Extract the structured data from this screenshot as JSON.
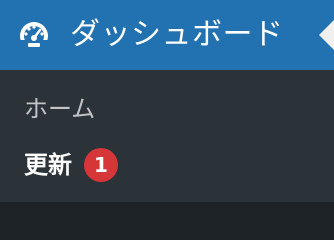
{
  "menu": {
    "dashboard": {
      "label": "ダッシュボード",
      "icon": "dashboard-gauge-icon"
    },
    "submenu": [
      {
        "label": "ホーム"
      },
      {
        "label": "更新",
        "badge": "1"
      }
    ]
  },
  "colors": {
    "sidebar_bg": "#1d2327",
    "submenu_bg": "#2c3338",
    "active_bg": "#2271b1",
    "badge_bg": "#d63638"
  }
}
